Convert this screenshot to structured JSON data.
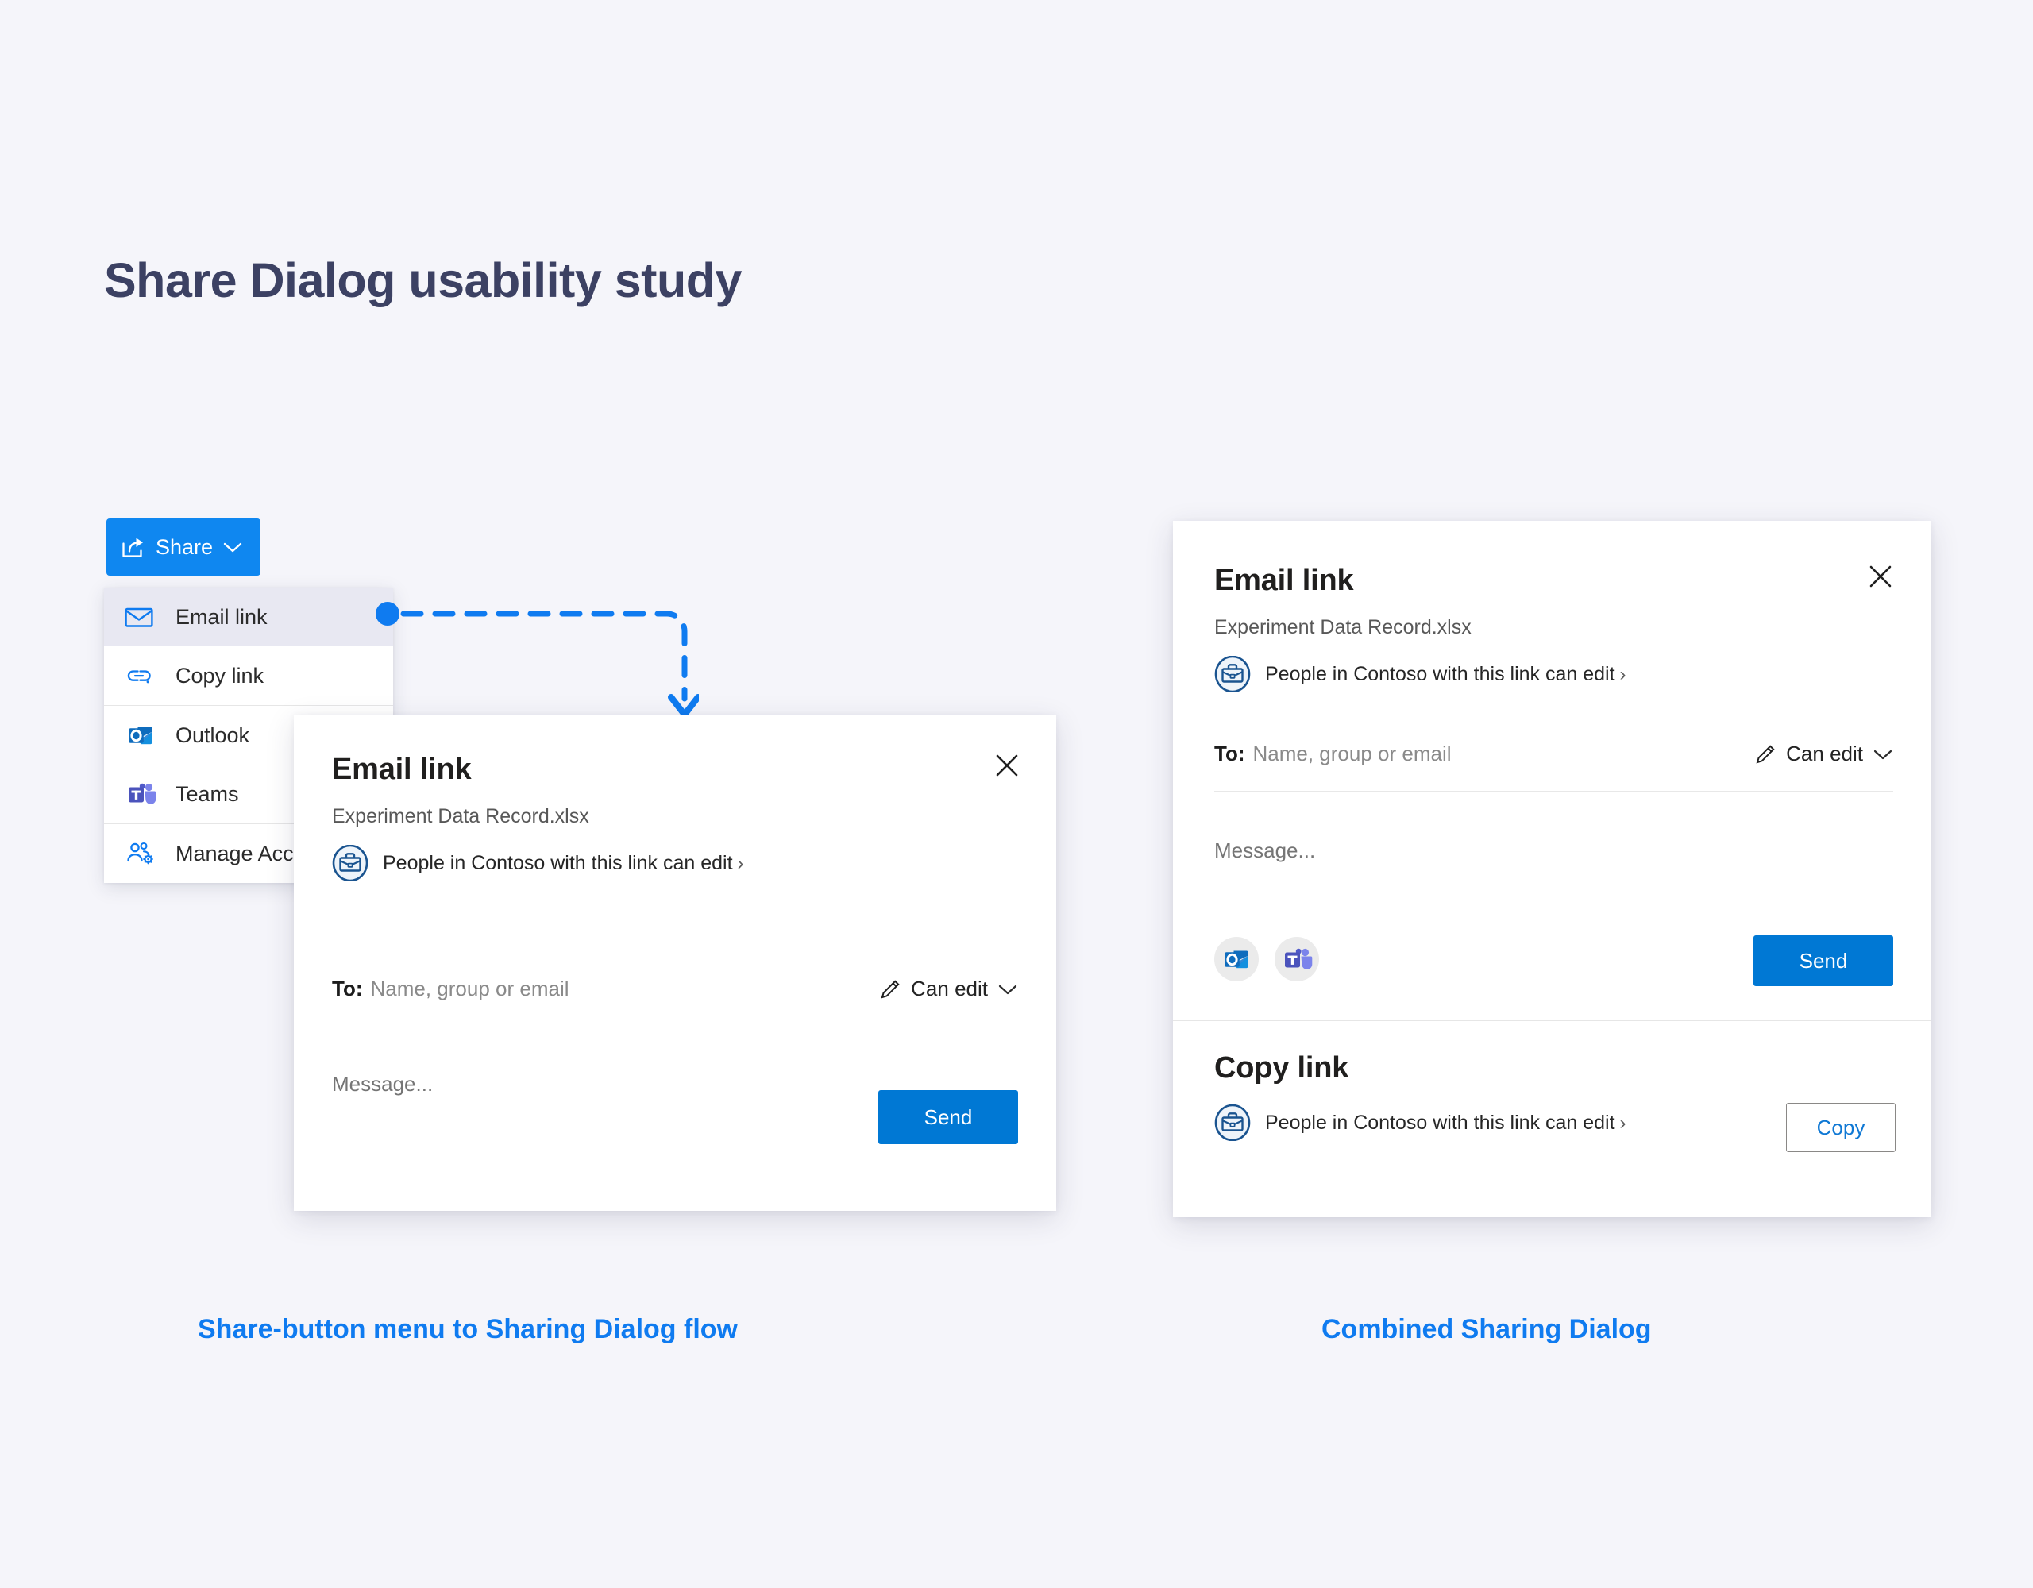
{
  "page": {
    "title": "Share Dialog usability study",
    "background_color": "#f5f5fa",
    "title_color": "#3c4163"
  },
  "share_button": {
    "label": "Share",
    "icon": "share-arrow-icon",
    "chevron": "chevron-down-icon",
    "background_color": "#0f87f0",
    "text_color": "#ffffff"
  },
  "share_menu": {
    "items": [
      {
        "label": "Email link",
        "icon": "envelope-icon",
        "selected": true
      },
      {
        "label": "Copy link",
        "icon": "link-chain-icon",
        "selected": false
      },
      {
        "label": "Outlook",
        "icon": "outlook-icon",
        "selected": false
      },
      {
        "label": "Teams",
        "icon": "teams-icon",
        "selected": false
      },
      {
        "label": "Manage Access",
        "icon": "manage-access-icon",
        "selected": false
      }
    ],
    "selected_highlight_color": "#e8e8f2"
  },
  "connector": {
    "style": "dashed",
    "color": "#0f7bf0",
    "origin_marker": "dot",
    "end_marker": "arrow-down"
  },
  "email_link_dialog": {
    "title": "Email link",
    "file_name": "Experiment Data Record.xlsx",
    "close_icon": "close-icon",
    "permission": {
      "icon": "briefcase-circle-icon",
      "text": "People in Contoso with this link can edit",
      "chevron": "chevron-right-icon"
    },
    "to_label": "To:",
    "to_placeholder": "Name, group or email",
    "permission_dropdown": {
      "icon": "pencil-icon",
      "label": "Can edit",
      "chevron": "chevron-down-icon"
    },
    "message_placeholder": "Message...",
    "send_label": "Send",
    "send_color": "#0078d4"
  },
  "combined_dialog": {
    "email_section": {
      "title": "Email link",
      "file_name": "Experiment Data Record.xlsx",
      "close_icon": "close-icon",
      "permission": {
        "icon": "briefcase-circle-icon",
        "text": "People in Contoso with this link can edit",
        "chevron": "chevron-right-icon"
      },
      "to_label": "To:",
      "to_placeholder": "Name, group or email",
      "permission_dropdown": {
        "icon": "pencil-icon",
        "label": "Can edit",
        "chevron": "chevron-down-icon"
      },
      "message_placeholder": "Message...",
      "apps": [
        {
          "name": "Outlook",
          "icon": "outlook-icon"
        },
        {
          "name": "Teams",
          "icon": "teams-icon"
        }
      ],
      "send_label": "Send",
      "send_color": "#0078d4"
    },
    "copy_section": {
      "title": "Copy link",
      "permission": {
        "icon": "briefcase-circle-icon",
        "text": "People in Contoso with this link can edit",
        "chevron": "chevron-right-icon"
      },
      "copy_label": "Copy",
      "copy_text_color": "#0f78d4"
    }
  },
  "captions": {
    "left": "Share-button menu to Sharing Dialog flow",
    "right": "Combined Sharing Dialog",
    "color": "#0f7bf0"
  }
}
